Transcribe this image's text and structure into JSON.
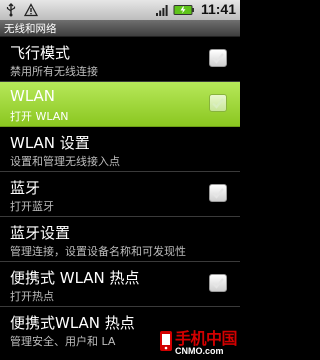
{
  "status_bar": {
    "time": "11:41",
    "icons": [
      "usb-icon",
      "warning-icon",
      "signal-bars-icon",
      "battery-charging-icon"
    ]
  },
  "title_bar": {
    "title": "无线和网络"
  },
  "settings": [
    {
      "title": "飞行模式",
      "subtitle": "禁用所有无线连接",
      "has_checkbox": true,
      "checked": false,
      "selected": false
    },
    {
      "title": "WLAN",
      "subtitle": "打开 WLAN",
      "has_checkbox": true,
      "checked": false,
      "selected": true
    },
    {
      "title": "WLAN 设置",
      "subtitle": "设置和管理无线接入点",
      "has_checkbox": false
    },
    {
      "title": "蓝牙",
      "subtitle": "打开蓝牙",
      "has_checkbox": true,
      "checked": false,
      "selected": false
    },
    {
      "title": "蓝牙设置",
      "subtitle": "管理连接，设置设备名称和可发现性",
      "has_checkbox": false
    },
    {
      "title": "便携式 WLAN 热点",
      "subtitle": "打开热点",
      "has_checkbox": true,
      "checked": false,
      "selected": false
    },
    {
      "title": "便携式WLAN 热点",
      "subtitle": "管理安全、用户和 LA",
      "has_checkbox": false
    }
  ],
  "watermark": {
    "brand": "手机中国",
    "site": "CNMO.com"
  },
  "colors": {
    "selected_row": "#9bd42f",
    "watermark_red": "#d20000"
  }
}
